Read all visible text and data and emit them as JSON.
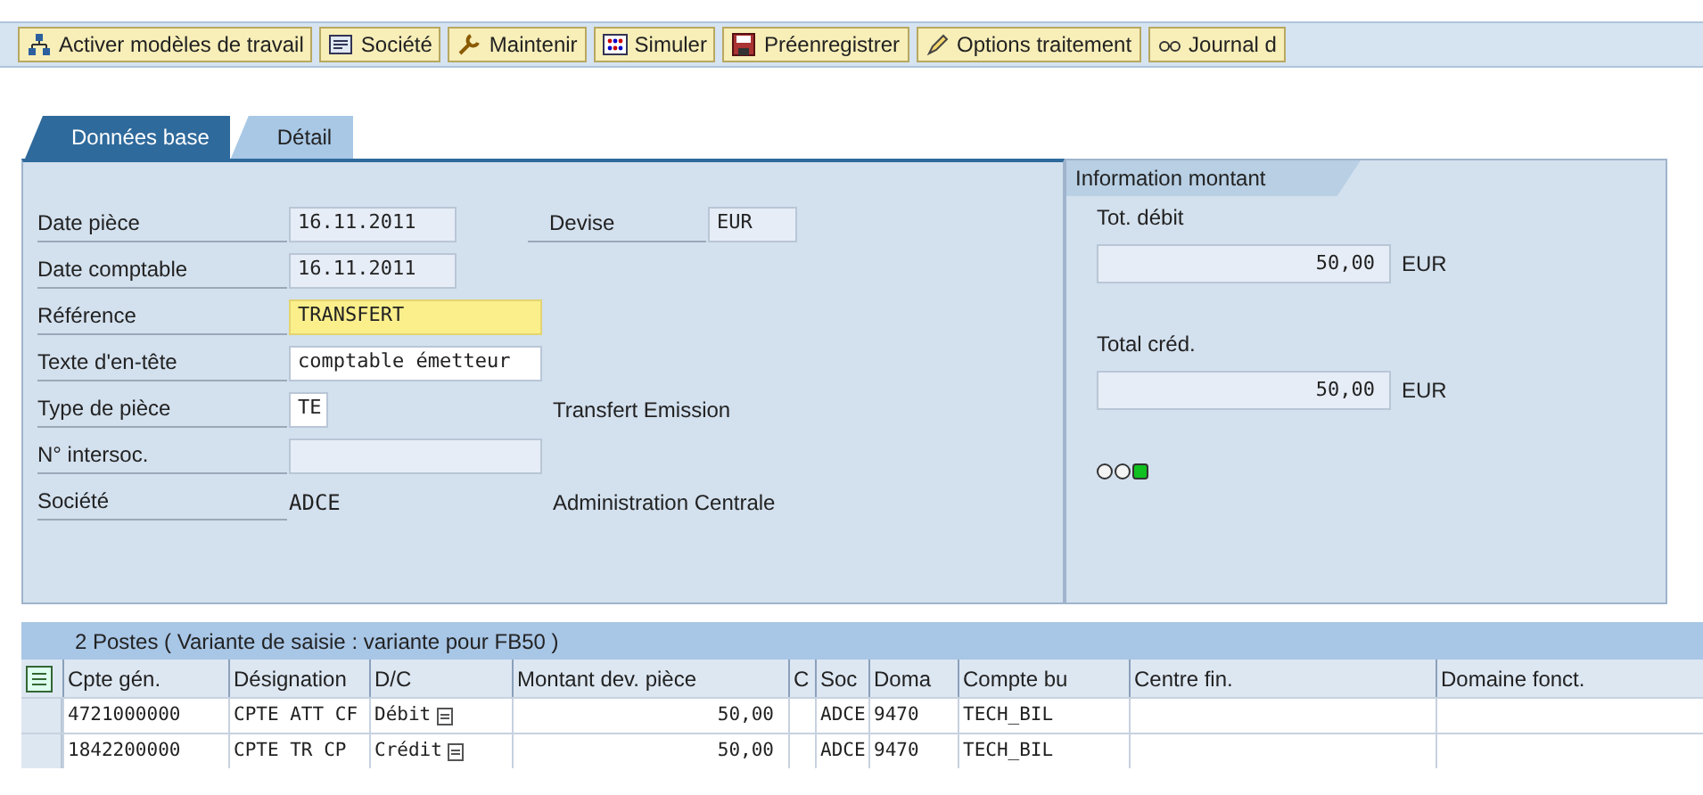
{
  "toolbar": [
    {
      "label": "Activer modèles de travail"
    },
    {
      "label": "Société"
    },
    {
      "label": "Maintenir"
    },
    {
      "label": "Simuler"
    },
    {
      "label": "Préenregistrer"
    },
    {
      "label": "Options traitement"
    },
    {
      "label": "Journal d"
    }
  ],
  "tabs": [
    {
      "label": "Données base",
      "selected": true
    },
    {
      "label": "Détail",
      "selected": false
    }
  ],
  "header_fields": [
    {
      "label": "Date pièce",
      "value": "16.11.2011",
      "kind": "display",
      "extra_label": "Devise",
      "extra_value": "EUR"
    },
    {
      "label": "Date comptable",
      "value": "16.11.2011",
      "kind": "display"
    },
    {
      "label": "Référence",
      "value": "TRANSFERT",
      "kind": "required"
    },
    {
      "label": "Texte d'en-tête",
      "value": "comptable émetteur",
      "kind": "input"
    },
    {
      "label": "Type de pièce",
      "value": "TE",
      "kind": "input",
      "description": "Transfert Emission"
    },
    {
      "label": "N° intersoc.",
      "kind": "display"
    },
    {
      "label": "Société",
      "value": "ADCE",
      "kind": "text",
      "description": "Administration Centrale"
    }
  ],
  "amount_info": {
    "title": "Information montant",
    "debit_label": "Tot. débit",
    "debit_value": "50,00",
    "debit_currency": "EUR",
    "credit_label": "Total créd.",
    "credit_value": "50,00",
    "credit_currency": "EUR",
    "lights": [
      {
        "on": false
      },
      {
        "on": false
      },
      {
        "on": true
      }
    ]
  },
  "items": {
    "title": "2 Postes ( Variante de saisie : variante pour FB50 )",
    "columns": [
      "Cpte gén.",
      "Désignation",
      "D/C",
      "Montant dev. pièce",
      "C",
      "Soc",
      "Doma",
      "Compte bu",
      "Centre fin.",
      "Domaine fonct."
    ],
    "rows": [
      {
        "cells": [
          "4721000000",
          "CPTE ATT CF",
          "Débit",
          "50,00",
          "",
          "ADCE",
          "9470",
          "TECH_BIL",
          "",
          ""
        ]
      },
      {
        "cells": [
          "1842200000",
          "CPTE TR CP",
          "Crédit",
          "50,00",
          "",
          "ADCE",
          "9470",
          "TECH_BIL",
          "",
          ""
        ]
      }
    ]
  }
}
